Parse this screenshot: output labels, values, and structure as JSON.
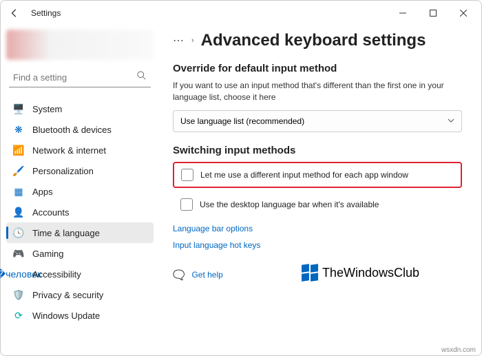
{
  "window": {
    "title": "Settings"
  },
  "search": {
    "placeholder": "Find a setting"
  },
  "nav": [
    {
      "label": "System",
      "icon": "🖥️",
      "color": "#0067c0"
    },
    {
      "label": "Bluetooth & devices",
      "icon": "❋",
      "color": "#0067c0"
    },
    {
      "label": "Network & internet",
      "icon": "📶",
      "color": "#555"
    },
    {
      "label": "Personalization",
      "icon": "🖌️",
      "color": "#0067c0"
    },
    {
      "label": "Apps",
      "icon": "▦",
      "color": "#0067c0"
    },
    {
      "label": "Accounts",
      "icon": "👤",
      "color": "#d88"
    },
    {
      "label": "Time & language",
      "icon": "🕓",
      "color": "#0aa"
    },
    {
      "label": "Gaming",
      "icon": "🎮",
      "color": "#555"
    },
    {
      "label": "Accessibility",
      "icon": "�человек",
      "color": "#0067c0"
    },
    {
      "label": "Privacy & security",
      "icon": "🛡️",
      "color": "#555"
    },
    {
      "label": "Windows Update",
      "icon": "⟳",
      "color": "#0aa"
    }
  ],
  "nav_active_index": 6,
  "breadcrumb": {
    "page_title": "Advanced keyboard settings"
  },
  "sections": {
    "override": {
      "title": "Override for default input method",
      "desc": "If you want to use an input method that's different than the first one in your language list, choose it here",
      "dropdown_value": "Use language list (recommended)"
    },
    "switching": {
      "title": "Switching input methods",
      "check1": "Let me use a different input method for each app window",
      "check2": "Use the desktop language bar when it's available",
      "link1": "Language bar options",
      "link2": "Input language hot keys"
    }
  },
  "help": {
    "label": "Get help"
  },
  "watermark": "TheWindowsClub",
  "attribution": "wsxdn.com"
}
